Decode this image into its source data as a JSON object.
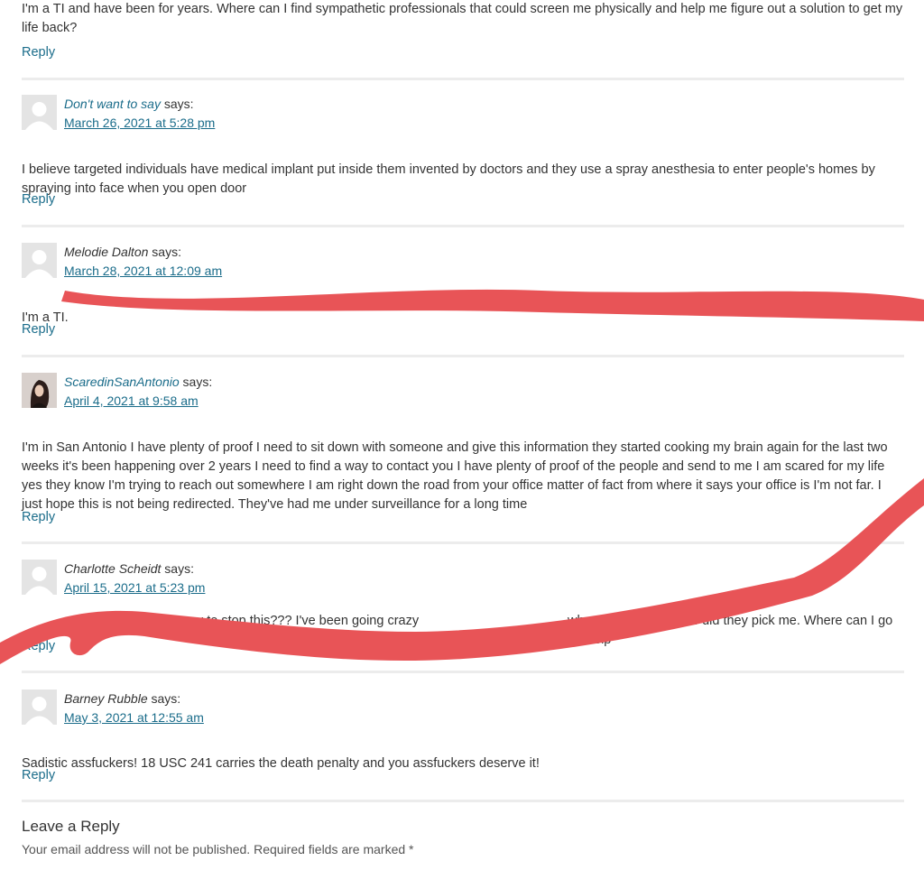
{
  "top_comment": {
    "text": "I'm a TI and have been for years. Where can I find sympathetic professionals that could screen me physically and help me figure out a solution to get my life back?",
    "reply_label": "Reply"
  },
  "comments": [
    {
      "author": "Don't want to say",
      "says": "says:",
      "date": "March 26, 2021 at 5:28 pm",
      "text": "I believe targeted individuals have medical implant put inside them invented by doctors and they use a spray anesthesia to enter people's homes by spraying into face when you open door",
      "reply_label": "Reply"
    },
    {
      "author": "Melodie Dalton",
      "says": "says:",
      "date": "March 28, 2021 at 12:09 am",
      "text": "I'm a TI.",
      "reply_label": "Reply"
    },
    {
      "author": "ScaredinSanAntonio",
      "says": "says:",
      "date": "April 4, 2021 at 9:58 am",
      "text": "I'm in San Antonio I have plenty of proof I need to sit down with someone and give this information they started cooking my brain again for the last two weeks it's been happening over 2 years I need to find a way to contact you I have plenty of proof of the people and send to me I am scared for my life yes they know I'm trying to reach out somewhere I am right down the road from your office matter of fact from where it says your office is I'm not far. I just hope this is not being redirected. They've had me under surveillance for a long time",
      "reply_label": "Reply"
    },
    {
      "author": "Charlotte Scheidt",
      "says": "says:",
      "date": "April 15, 2021 at 5:23 pm",
      "text_left": "anyway to stop this??? I've been going crazy",
      "text_right": "why and why me. How did they pick me. Where can I go for help",
      "reply_label": "Reply"
    },
    {
      "author": "Barney Rubble",
      "says": "says:",
      "date": "May 3, 2021 at 12:55 am",
      "text": "Sadistic assfuckers! 18 USC 241 carries the death penalty and you assfuckers deserve it!",
      "reply_label": "Reply"
    }
  ],
  "leave_reply": {
    "title": "Leave a Reply",
    "notes": "Your email address will not be published. Required fields are marked *"
  },
  "colors": {
    "link": "#1a6c8a",
    "scribble": "#e85457",
    "separator": "#ececec"
  },
  "icons": {
    "avatar_placeholder": "user-silhouette-icon"
  }
}
